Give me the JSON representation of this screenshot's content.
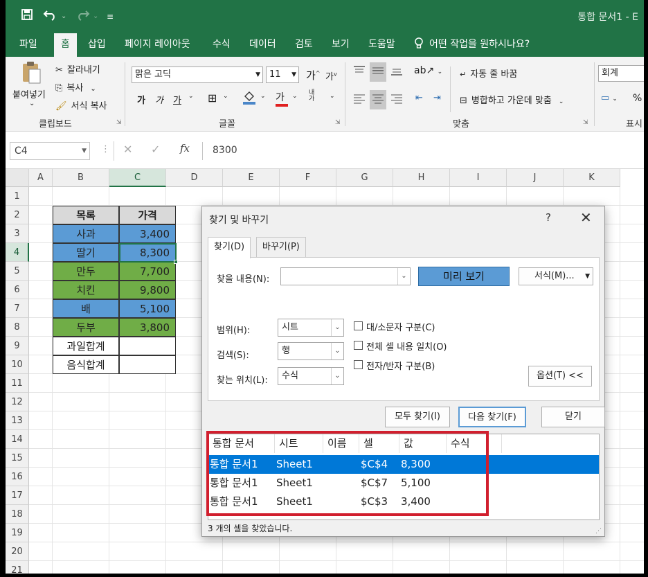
{
  "titlebar": {
    "doc_title": "통합 문서1  -  E",
    "save_icon": "save-icon",
    "undo_icon": "undo-icon",
    "redo_icon": "redo-icon"
  },
  "tabs": [
    "파일",
    "홈",
    "삽입",
    "페이지 레이아웃",
    "수식",
    "데이터",
    "검토",
    "보기",
    "도움말"
  ],
  "active_tab": "홈",
  "tellme": "어떤 작업을 원하시나요?",
  "ribbon": {
    "clipboard": {
      "paste": "붙여넣기",
      "cut": "잘라내기",
      "copy": "복사",
      "format_painter": "서식 복사",
      "label": "클립보드"
    },
    "font": {
      "name": "맑은 고딕",
      "size": "11",
      "label": "글꼴"
    },
    "align": {
      "wrap": "자동 줄 바꿈",
      "merge": "병합하고 가운데 맞춤",
      "label": "맞춤"
    },
    "number": {
      "format": "회계",
      "label": "표시"
    }
  },
  "formula_bar": {
    "cell_ref": "C4",
    "value": "8300"
  },
  "columns": [
    "A",
    "B",
    "C",
    "D",
    "E",
    "F",
    "G",
    "H",
    "I",
    "J",
    "K"
  ],
  "rows": [
    "1",
    "2",
    "3",
    "4",
    "5",
    "6",
    "7",
    "8",
    "9",
    "10",
    "11",
    "12",
    "13",
    "14",
    "15",
    "16",
    "17",
    "18",
    "19",
    "20",
    "21"
  ],
  "table": {
    "header": [
      "목록",
      "가격"
    ],
    "rows": [
      {
        "item": "사과",
        "price": "3,400",
        "color": "#5b9bd5"
      },
      {
        "item": "딸기",
        "price": "8,300",
        "color": "#5b9bd5"
      },
      {
        "item": "만두",
        "price": "7,700",
        "color": "#70ad47"
      },
      {
        "item": "치킨",
        "price": "9,800",
        "color": "#70ad47"
      },
      {
        "item": "배",
        "price": "5,100",
        "color": "#5b9bd5"
      },
      {
        "item": "두부",
        "price": "3,800",
        "color": "#70ad47"
      },
      {
        "item": "과일합계",
        "price": "",
        "color": "#ffffff"
      },
      {
        "item": "음식합계",
        "price": "",
        "color": "#ffffff"
      }
    ]
  },
  "dialog": {
    "title": "찾기 및 바꾸기",
    "help": "?",
    "tabs": [
      "찾기(D)",
      "바꾸기(P)"
    ],
    "find_label": "찾을 내용(N):",
    "find_value": "",
    "preview_button": "미리 보기",
    "format_button": "서식(M)...",
    "scope_label": "범위(H):",
    "scope_value": "시트",
    "search_label": "검색(S):",
    "search_value": "행",
    "lookin_label": "찾는 위치(L):",
    "lookin_value": "수식",
    "opt_case": "대/소문자 구분(C)",
    "opt_entire": "전체 셀 내용 일치(O)",
    "opt_width": "전자/반자 구분(B)",
    "options_button": "옵션(T) <<",
    "find_all": "모두 찾기(I)",
    "find_next": "다음 찾기(F)",
    "close": "닫기",
    "result_headers": [
      "통합 문서",
      "시트",
      "이름",
      "셀",
      "값",
      "수식"
    ],
    "results": [
      {
        "book": "통합 문서1",
        "sheet": "Sheet1",
        "name": "",
        "cell": "$C$4",
        "value": "8,300",
        "formula": ""
      },
      {
        "book": "통합 문서1",
        "sheet": "Sheet1",
        "name": "",
        "cell": "$C$7",
        "value": "5,100",
        "formula": ""
      },
      {
        "book": "통합 문서1",
        "sheet": "Sheet1",
        "name": "",
        "cell": "$C$3",
        "value": "3,400",
        "formula": ""
      }
    ],
    "status": "3 개의 셀을 찾았습니다."
  }
}
